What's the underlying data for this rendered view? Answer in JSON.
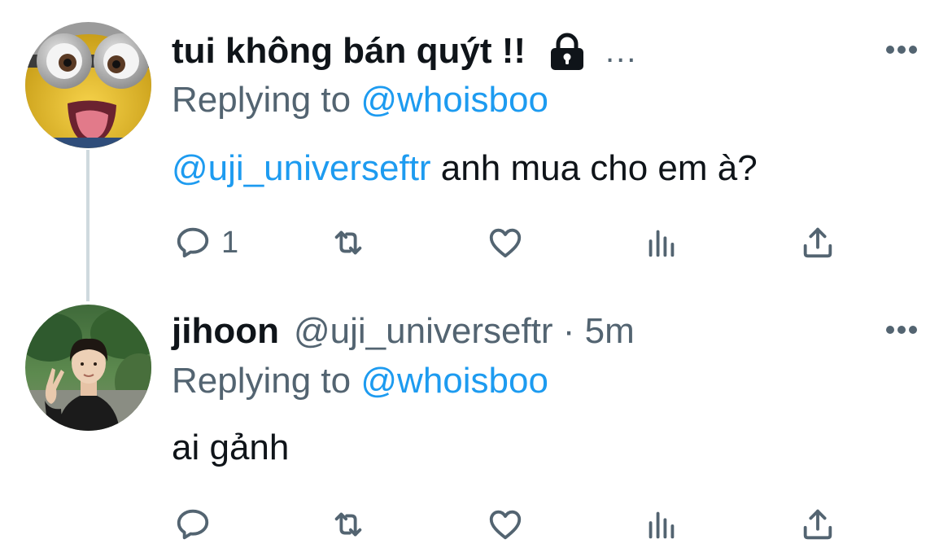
{
  "tweets": [
    {
      "display_name": "tui không bán quýt !!",
      "protected_icon": "lock-icon",
      "truncation": "...",
      "replying_prefix": "Replying to",
      "replying_handle": "@whoisboo",
      "mention": "@uji_universeftr",
      "text": " anh mua cho em à?",
      "reply_count": "1",
      "avatar": "minion-avatar"
    },
    {
      "display_name": "jihoon",
      "handle_time": "@uji_universeftr · 5m",
      "replying_prefix": "Replying to",
      "replying_handle": "@whoisboo",
      "text": "ai gảnh",
      "reply_count": "",
      "avatar": "photo-avatar"
    }
  ],
  "icons": {
    "more": "more-icon",
    "reply": "reply-icon",
    "retweet": "retweet-icon",
    "like": "heart-icon",
    "views": "views-icon",
    "share": "share-icon"
  },
  "colors": {
    "link": "#1d9bf0",
    "secondary_text": "#536471",
    "primary_text": "#0f1419",
    "thread_line": "#cfd9de"
  }
}
